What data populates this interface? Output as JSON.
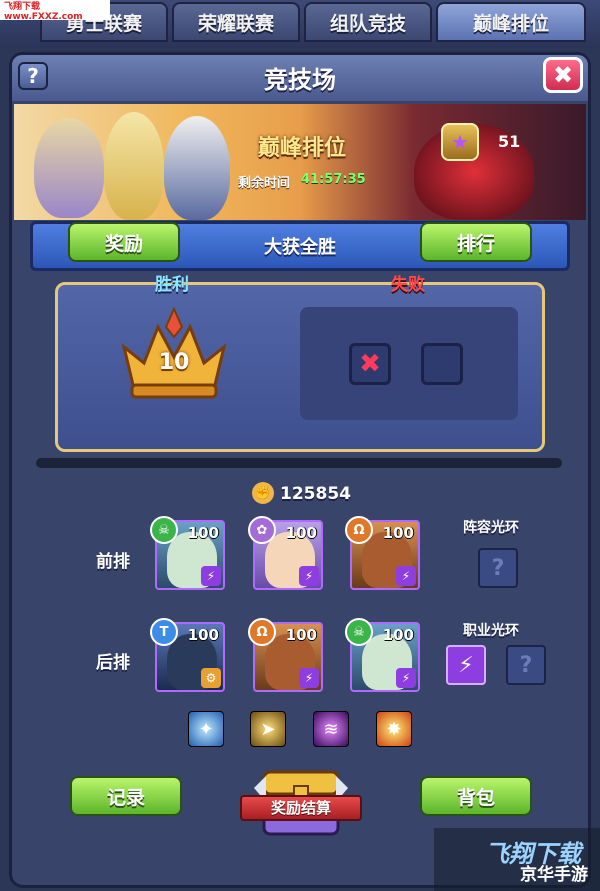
{
  "watermark": "飞翔下载 www.FXXZ.com",
  "top_tabs": [
    "勇士联赛",
    "荣耀联赛",
    "组队竞技",
    "巅峰排位"
  ],
  "active_tab": 3,
  "window": {
    "title": "竞技场",
    "help_label": "?",
    "close_label": "✖"
  },
  "banner": {
    "title": "巅峰排位",
    "time_label": "剩余时间",
    "time_value": "41:57:35",
    "rank_value": "51",
    "rank_icon": "star-badge-icon"
  },
  "ribbon": {
    "left_button": "奖励",
    "center_title": "大获全胜",
    "right_button": "排行"
  },
  "record": {
    "win_label": "胜利",
    "lose_label": "失败",
    "win_count": "10",
    "loss_marks": [
      "✖",
      ""
    ]
  },
  "team": {
    "power": "125854",
    "front_label": "前排",
    "back_label": "后排",
    "front": [
      {
        "level": "100",
        "faction": "undead",
        "faction_color": "#3bb54a"
      },
      {
        "level": "100",
        "faction": "nature",
        "faction_color": "#a56bd8"
      },
      {
        "level": "100",
        "faction": "fortress",
        "faction_color": "#e0782a"
      }
    ],
    "back": [
      {
        "level": "100",
        "faction": "shadow",
        "faction_color": "#3d8de8"
      },
      {
        "level": "100",
        "faction": "fortress",
        "faction_color": "#e0782a"
      },
      {
        "level": "100",
        "faction": "undead",
        "faction_color": "#3bb54a"
      }
    ],
    "formation_aura_label": "阵容光环",
    "class_aura_label": "职业光环",
    "unknown": "?"
  },
  "skills": [
    "frost-skill-icon",
    "dash-skill-icon",
    "claw-skill-icon",
    "burst-skill-icon"
  ],
  "bottom": {
    "record_button": "记录",
    "chest_label": "奖励结算",
    "bag_button": "背包"
  },
  "logo": {
    "line1": "飞翔下载",
    "line2": "京华手游"
  }
}
